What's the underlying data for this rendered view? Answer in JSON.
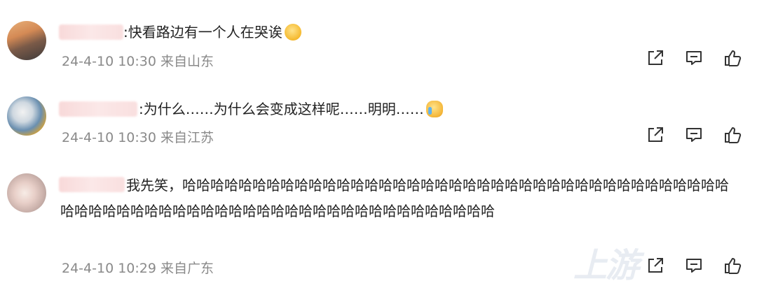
{
  "comments": [
    {
      "text": ":快看路边有一个人在哭诶",
      "emoji": "grin-emoji",
      "date": "24-4-10 10:30",
      "location": "来自山东"
    },
    {
      "text": ":为什么……为什么会变成这样呢……明明……",
      "emoji": "crying-duck-emoji",
      "date": "24-4-10 10:30",
      "location": "来自江苏"
    },
    {
      "text": "我先笑，哈哈哈哈哈哈哈哈哈哈哈哈哈哈哈哈哈哈哈哈哈哈哈哈哈哈哈哈哈哈哈哈哈哈哈哈哈哈哈哈哈哈哈哈哈哈哈哈哈哈哈哈哈哈哈哈哈哈哈哈哈哈哈哈哈哈哈哈哈哈",
      "date": "24-4-10 10:29",
      "location": "来自广东"
    }
  ],
  "actions": {
    "share_icon": "share-icon",
    "comment_icon": "comment-icon",
    "like_icon": "thumbs-up-icon"
  },
  "watermark": "上游"
}
